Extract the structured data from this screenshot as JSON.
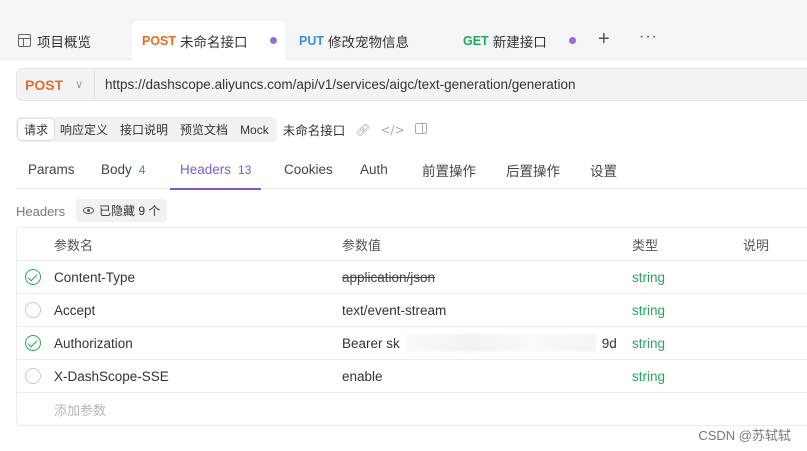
{
  "tabs": {
    "overview": {
      "label": "项目概览",
      "icon": "table-icon"
    },
    "active": {
      "method": "POST",
      "label": "未命名接口",
      "dot": true
    },
    "put": {
      "method": "PUT",
      "label": "修改宠物信息"
    },
    "get": {
      "method": "GET",
      "label": "新建接口",
      "dot": true
    },
    "add": "+",
    "more": "···"
  },
  "url_bar": {
    "method": "POST",
    "url": "https://dashscope.aliyuncs.com/api/v1/services/aigc/text-generation/generation"
  },
  "sub_toolbar": {
    "items": [
      "请求",
      "响应定义",
      "接口说明",
      "预览文档",
      "Mock"
    ],
    "active_index": 0,
    "api_name": "未命名接口",
    "icons": [
      "link-icon",
      "code-icon",
      "panel-icon"
    ]
  },
  "request_tabs": [
    {
      "label": "Params",
      "count": ""
    },
    {
      "label": "Body",
      "count": "4"
    },
    {
      "label": "Headers",
      "count": "13",
      "active": true
    },
    {
      "label": "Cookies",
      "count": ""
    },
    {
      "label": "Auth",
      "count": ""
    },
    {
      "label": "前置操作",
      "count": ""
    },
    {
      "label": "后置操作",
      "count": ""
    },
    {
      "label": "设置",
      "count": ""
    }
  ],
  "headers_section": {
    "label": "Headers",
    "hidden_pill": "已隐藏 9 个"
  },
  "table": {
    "columns": {
      "name": "参数名",
      "value": "参数值",
      "type": "类型",
      "desc": "说明"
    },
    "rows": [
      {
        "checked": true,
        "name": "Content-Type",
        "value": "application/json",
        "strikethrough": true,
        "type": "string"
      },
      {
        "checked": false,
        "name": "Accept",
        "value": "text/event-stream",
        "type": "string"
      },
      {
        "checked": true,
        "name": "Authorization",
        "value_prefix": "Bearer sk",
        "value_suffix": "9d",
        "redacted": true,
        "type": "string"
      },
      {
        "checked": false,
        "name": "X-DashScope-SSE",
        "value": "enable",
        "type": "string"
      }
    ],
    "add_placeholder": "添加参数"
  },
  "watermark": "CSDN @苏轼轼",
  "colors": {
    "post": "#e56b29",
    "put": "#3b8ee0",
    "get": "#26a65b",
    "accent": "#7b5bd6",
    "type_string": "#26a65b"
  }
}
